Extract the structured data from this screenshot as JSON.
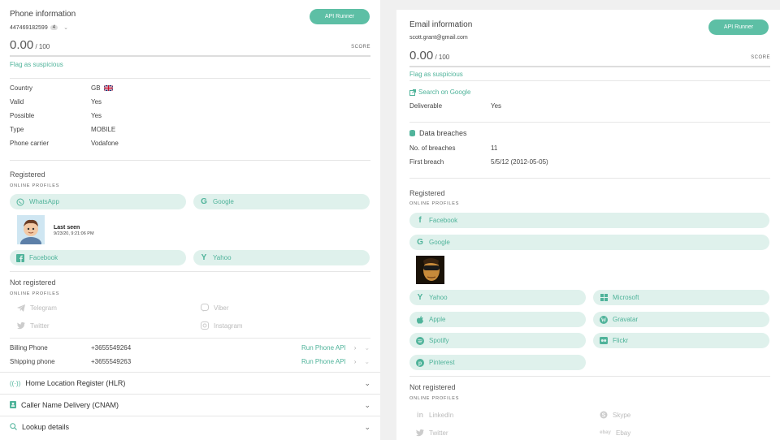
{
  "phone": {
    "title": "Phone information",
    "number": "447469182599",
    "badge": "4",
    "api_button": "API Runner",
    "score_value": "0.00",
    "score_max": "/ 100",
    "score_label": "SCORE",
    "flag_link": "Flag as suspicious",
    "details": [
      {
        "key": "Country",
        "value": "GB"
      },
      {
        "key": "Valid",
        "value": "Yes"
      },
      {
        "key": "Possible",
        "value": "Yes"
      },
      {
        "key": "Type",
        "value": "MOBILE"
      },
      {
        "key": "Phone carrier",
        "value": "Vodafone"
      }
    ],
    "registered_title": "Registered",
    "online_profiles_label": "ONLINE PROFILES",
    "registered_profiles": [
      "WhatsApp",
      "Google",
      "Facebook",
      "Yahoo"
    ],
    "last_seen_label": "Last seen",
    "last_seen_value": "9/23/20, 9:21:06 PM",
    "not_registered_title": "Not registered",
    "not_registered_profiles": [
      "Telegram",
      "Viber",
      "Twitter",
      "Instagram"
    ],
    "billing_label": "Billing Phone",
    "billing_value": "+3655549264",
    "shipping_label": "Shipping phone",
    "shipping_value": "+3655549263",
    "run_phone_api": "Run Phone API",
    "accordions": [
      "Home Location Register (HLR)",
      "Caller Name Delivery (CNAM)",
      "Lookup details"
    ]
  },
  "email": {
    "title": "Email information",
    "address": "scott.grant@gmail.com",
    "api_button": "API Runner",
    "score_value": "0.00",
    "score_max": "/ 100",
    "score_label": "SCORE",
    "flag_link": "Flag as suspicious",
    "search_google": "Search on Google",
    "deliverable_label": "Deliverable",
    "deliverable_value": "Yes",
    "breaches_title": "Data breaches",
    "breaches_count_label": "No. of breaches",
    "breaches_count_value": "11",
    "first_breach_label": "First breach",
    "first_breach_value": "5/5/12 (2012-05-05)",
    "registered_title": "Registered",
    "online_profiles_label": "ONLINE PROFILES",
    "registered_profiles": [
      "Facebook",
      "Google",
      "Yahoo",
      "Microsoft",
      "Apple",
      "Gravatar",
      "Spotify",
      "Flickr",
      "Pinterest"
    ],
    "not_registered_title": "Not registered",
    "not_registered_profiles": [
      "LinkedIn",
      "Skype",
      "Twitter",
      "Ebay"
    ]
  },
  "colors": {
    "accent": "#5dbfa5",
    "pill_bg": "#dff1ec",
    "pill_text": "#4fb39a"
  }
}
